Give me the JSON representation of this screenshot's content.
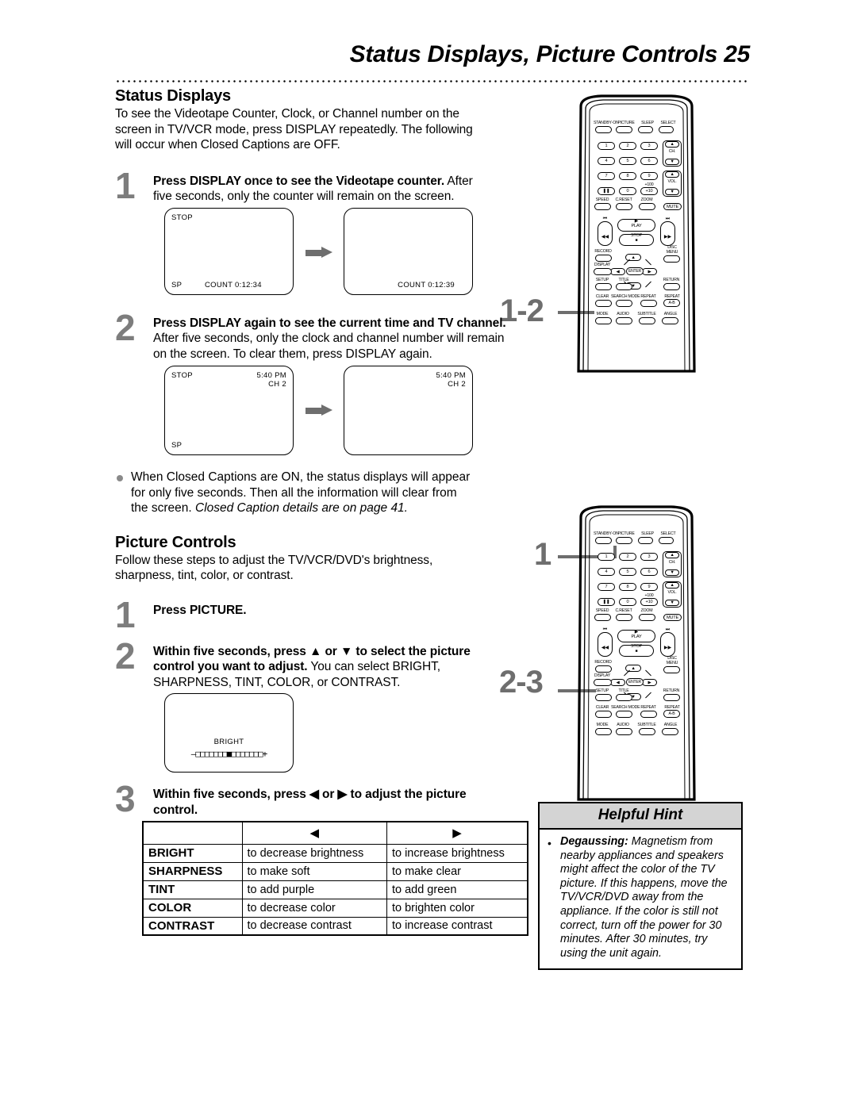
{
  "header": {
    "title": "Status Displays, Picture Controls  25"
  },
  "sections": {
    "status_displays": {
      "heading": "Status Displays",
      "intro": "To see the Videotape Counter, Clock, or Channel number on the screen in TV/VCR mode, press DISPLAY repeatedly. The following will occur when Closed Captions are OFF.",
      "steps": [
        {
          "num": "1",
          "lead": "Press DISPLAY once to see the Videotape counter.",
          "rest": " After five seconds, only the counter will remain on the screen."
        },
        {
          "num": "2",
          "lead": "Press DISPLAY again to see the current time and TV channel.",
          "rest": " After five seconds, only the clock and channel number will remain on the screen. To clear them, press DISPLAY again."
        }
      ],
      "note": {
        "text": "When Closed Captions are ON, the status displays will appear for only five seconds. Then all the information will clear from the screen. ",
        "italic": "Closed Caption details are on page 41."
      }
    },
    "picture_controls": {
      "heading": "Picture Controls",
      "intro": "Follow these steps to adjust the TV/VCR/DVD's brightness, sharpness, tint, color, or contrast.",
      "steps": [
        {
          "num": "1",
          "lead": "Press PICTURE.",
          "rest": ""
        },
        {
          "num": "2",
          "lead": "Within five seconds, press ▲ or ▼ to select the picture control you want to adjust.",
          "rest": " You can select BRIGHT, SHARPNESS, TINT, COLOR, or CONTRAST."
        },
        {
          "num": "3",
          "lead": "Within five seconds, press ◀ or ▶ to adjust the picture control.",
          "rest": ""
        }
      ]
    }
  },
  "tv_screens": {
    "step1_before": {
      "status": "STOP",
      "speed": "SP",
      "counter": "COUNT 0:12:34"
    },
    "step1_after": {
      "counter": "COUNT 0:12:39"
    },
    "step2_before": {
      "status": "STOP",
      "time": "5:40 PM",
      "channel": "CH 2",
      "speed": "SP"
    },
    "step2_after": {
      "time": "5:40 PM",
      "channel": "CH 2"
    },
    "bright": {
      "label": "BRIGHT",
      "bar": "–□□□□□□□■□□□□□□□+"
    }
  },
  "control_table": {
    "columns": [
      "",
      "◀",
      "▶"
    ],
    "rows": [
      {
        "label": "BRIGHT",
        "left": "to decrease brightness",
        "right": "to increase brightness"
      },
      {
        "label": "SHARPNESS",
        "left": "to make soft",
        "right": "to make clear"
      },
      {
        "label": "TINT",
        "left": "to add purple",
        "right": "to add green"
      },
      {
        "label": "COLOR",
        "left": "to decrease color",
        "right": "to brighten color"
      },
      {
        "label": "CONTRAST",
        "left": "to decrease contrast",
        "right": "to increase contrast"
      }
    ]
  },
  "helpful_hint": {
    "title": "Helpful Hint",
    "bullet": "•",
    "term": "Degaussing:",
    "text": " Magnetism from nearby appliances and speakers might affect the color of the TV picture. If this happens, move the TV/VCR/DVD away from the appliance. If the color is still not correct, turn off the power for 30 minutes. After 30 minutes, try using the unit again."
  },
  "callouts": {
    "top_remote": "1-2",
    "bottom_remote_first": "1",
    "bottom_remote_second": "2-3"
  },
  "remote": {
    "row_top": [
      "STANDBY·ON",
      "PICTURE",
      "SLEEP",
      "SELECT"
    ],
    "numbers": [
      "1",
      "2",
      "3",
      "4",
      "5",
      "6",
      "7",
      "8",
      "9",
      "❚❚",
      "0",
      "+10"
    ],
    "plus100": "+100",
    "ch_label": "CH.",
    "vol_label": "VOL.",
    "row_func": [
      "SPEED",
      "C.RESET",
      "ZOOM"
    ],
    "mute": "MUTE",
    "play": "PLAY",
    "stop": "STOP",
    "record": "RECORD",
    "disc_menu": [
      "DISC",
      "MENU"
    ],
    "display": "DISPLAY",
    "enter": "ENTER",
    "row_setup": [
      "SETUP",
      "TITLE",
      "RETURN"
    ],
    "row_clear": [
      "CLEAR",
      "SEARCH MODE",
      "REPEAT",
      "REPEAT"
    ],
    "repeat_ab": "A-B",
    "row_mode": [
      "MODE",
      "AUDIO",
      "SUBTITLE",
      "ANGLE"
    ]
  }
}
